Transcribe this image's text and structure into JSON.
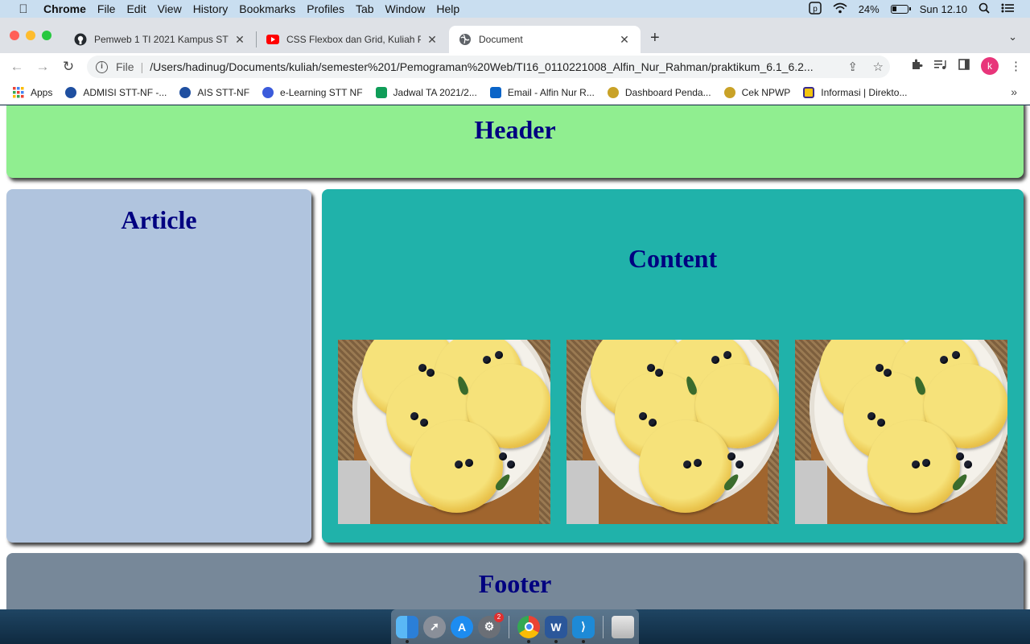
{
  "menubar": {
    "app": "Chrome",
    "items": [
      "File",
      "Edit",
      "View",
      "History",
      "Bookmarks",
      "Profiles",
      "Tab",
      "Window",
      "Help"
    ],
    "battery": "24%",
    "clock": "Sun 12.10"
  },
  "tabs": [
    {
      "title": "Pemweb 1 TI 2021 Kampus STT",
      "icon": "github-icon"
    },
    {
      "title": "CSS Flexbox dan Grid, Kuliah P",
      "icon": "youtube-icon"
    },
    {
      "title": "Document",
      "icon": "globe-icon",
      "active": true
    }
  ],
  "toolbar": {
    "scheme_label": "File",
    "url": "/Users/hadinug/Documents/kuliah/semester%201/Pemograman%20Web/TI16_0110221008_Alfin_Nur_Rahman/praktikum_6.1_6.2..."
  },
  "profile": {
    "initial": "k",
    "color": "#e8357a"
  },
  "bookmarks": [
    {
      "label": "Apps",
      "color": "#4285f4"
    },
    {
      "label": "ADMISI STT-NF -...",
      "color": "#1f4fa0"
    },
    {
      "label": "AIS STT-NF",
      "color": "#1f4fa0"
    },
    {
      "label": "e-Learning STT NF",
      "color": "#3b5bdb"
    },
    {
      "label": "Jadwal TA 2021/2...",
      "color": "#0f9d58"
    },
    {
      "label": "Email - Alfin Nur R...",
      "color": "#0a64c8"
    },
    {
      "label": "Dashboard Penda...",
      "color": "#c9a227"
    },
    {
      "label": "Cek NPWP",
      "color": "#c9a227"
    },
    {
      "label": "Informasi | Direkto...",
      "color": "#f2c40f"
    }
  ],
  "page": {
    "header": "Header",
    "article": "Article",
    "content": "Content",
    "footer": "Footer",
    "colors": {
      "header": "#90ee90",
      "article": "#b0c4de",
      "content": "#20b2aa",
      "footer": "#778899",
      "heading": "#000080"
    }
  },
  "dock": {
    "apps": [
      "finder-icon",
      "launchpad-icon",
      "app-store-icon",
      "system-preferences-icon",
      "chrome-icon",
      "word-icon",
      "vscode-icon",
      "trash-icon"
    ],
    "badge": "2"
  }
}
